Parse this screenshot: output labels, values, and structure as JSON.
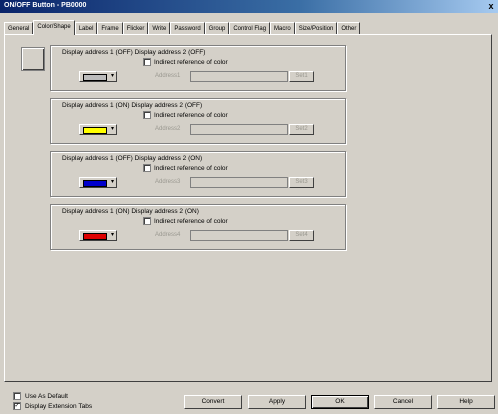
{
  "window": {
    "title": "ON/OFF Button - PB0000",
    "close": "x"
  },
  "tabs": [
    "General",
    "Color/Shape",
    "Label",
    "Frame",
    "Flicker",
    "Write",
    "Password",
    "Group",
    "Control Flag",
    "Macro",
    "Size/Position",
    "Other"
  ],
  "active_tab": "Color/Shape",
  "groups": [
    {
      "label": "Display address 1 (OFF) Display address 2 (OFF)",
      "indirect": "Indirect reference of color",
      "address_label": "Address1",
      "set": "Set1",
      "color": "#bcbcbc"
    },
    {
      "label": "Display address 1 (ON) Display address 2 (OFF)",
      "indirect": "Indirect reference of color",
      "address_label": "Address2",
      "set": "Set2",
      "color": "#ffff00"
    },
    {
      "label": "Display address 1 (OFF) Display address 2 (ON)",
      "indirect": "Indirect reference of color",
      "address_label": "Address3",
      "set": "Set3",
      "color": "#0000cc"
    },
    {
      "label": "Display address 1 (ON) Display address 2 (ON)",
      "indirect": "Indirect reference of color",
      "address_label": "Address4",
      "set": "Set4",
      "color": "#dd0000"
    }
  ],
  "footer": {
    "use_as_default": "Use As Default",
    "display_extension_tabs": "Display Extension Tabs",
    "display_extension_tabs_checked": "✓",
    "buttons": {
      "convert": "Convert",
      "apply": "Apply",
      "ok": "OK",
      "cancel": "Cancel",
      "help": "Help"
    }
  }
}
